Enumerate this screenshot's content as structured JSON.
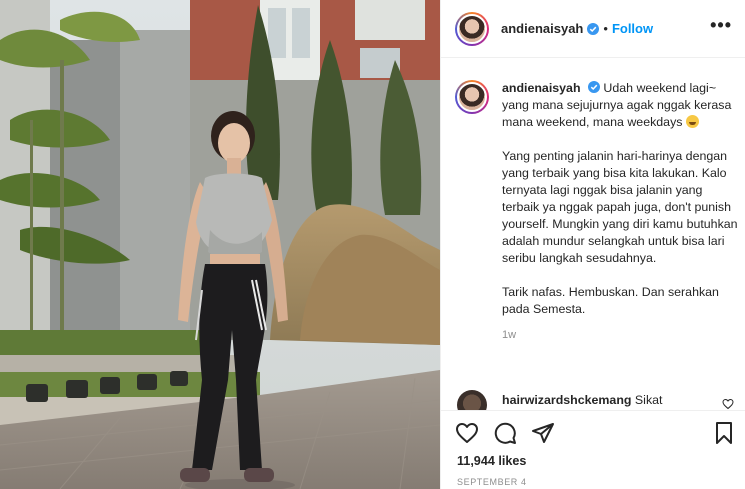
{
  "post": {
    "username": "andienaisyah",
    "follow_label": "Follow",
    "separator": "•",
    "more_label": "•••",
    "caption_paragraphs": [
      "Udah weekend lagi~ yang mana sejujurnya agak nggak kerasa mana weekend, mana weekdays",
      "Yang penting jalanin hari-harinya dengan yang terbaik yang bisa kita lakukan. Kalo ternyata lagi nggak bisa jalanin yang terbaik ya nggak papah juga, don't punish yourself. Mungkin yang diri kamu butuhkan adalah mundur selangkah untuk bisa lari seribu langkah sesudahnya.",
      "Tarik nafas. Hembuskan. Dan serahkan pada Semesta."
    ],
    "caption_emoji": "laughing-emoji",
    "time_ago": "1w",
    "likes": "11,944 likes",
    "date": "SEPTEMBER 4"
  },
  "comment": {
    "username": "hairwizardshckemang",
    "text": "Sikat"
  },
  "icons": [
    "verified-badge-icon",
    "heart-icon",
    "comment-icon",
    "share-icon",
    "bookmark-icon",
    "more-icon"
  ],
  "colors": {
    "link_blue": "#0095f6",
    "text": "#262626",
    "muted": "#8e8e8e",
    "border": "#efefef"
  }
}
